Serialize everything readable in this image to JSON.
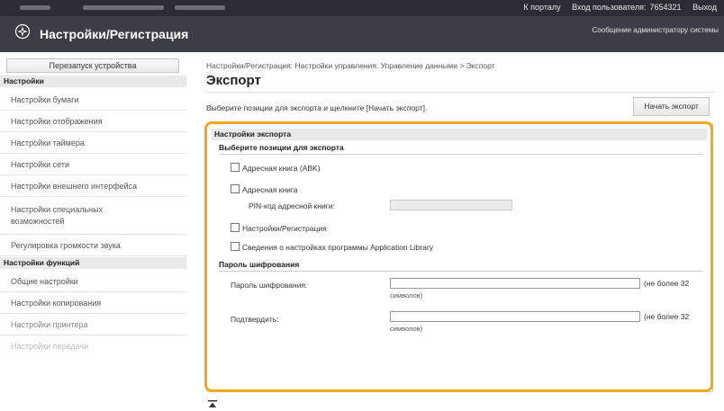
{
  "topbar": {
    "portal_link": "К порталу",
    "login_user_label": "Вход пользователя:",
    "user_id": "7654321",
    "logout_link": "Выход"
  },
  "header": {
    "title": "Настройки/Регистрация",
    "admin_link": "Сообщение администратору системы"
  },
  "sidebar": {
    "restart_button": "Перезапуск устройства",
    "section_settings": "Настройки",
    "settings_items": [
      "Настройки бумаги",
      "Настройки отображения",
      "Настройки таймера",
      "Настройки сети",
      "Настройки внешнего интерфейса",
      "Настройки специальных возможностей",
      "Регулировка громкости звука"
    ],
    "section_functions": "Настройки функций",
    "function_items": [
      "Общие настройки",
      "Настройки копирования",
      "Настройки принтера",
      "Настройки передачи"
    ]
  },
  "main": {
    "breadcrumb": "Настройки/Регистрация: Настройки управления: Управление данными > Экспорт",
    "page_title": "Экспорт",
    "instruction": "Выберите позиции для экспорта и щелкните [Начать экспорт].",
    "start_export_button": "Начать экспорт",
    "panel_title": "Настройки экспорта",
    "select_items_header": "Выберите позиции для экспорта",
    "items": {
      "address_book_abk": "Адресная книга (ABK)",
      "address_book": "Адресная книга",
      "pin_label": "PIN-код адресной книги:",
      "settings_registration": "Настройки/Регистрация",
      "app_library": "Сведения о настройках программы Application Library"
    },
    "encryption_header": "Пароль шифрования",
    "encryption_password_label": "Пароль шифрования:",
    "confirm_label": "Подтвердить:",
    "max_note_1": "(не более 32",
    "max_note_2": "символов)",
    "checkboxes": {
      "abk": false,
      "address_book": false,
      "settings": false,
      "app_library": false
    },
    "top_icon": "scroll-to-top-icon"
  },
  "colors": {
    "highlight": "#f0a81c",
    "header_bg": "#3b3e44",
    "topbar_bg": "#2a2d33"
  }
}
